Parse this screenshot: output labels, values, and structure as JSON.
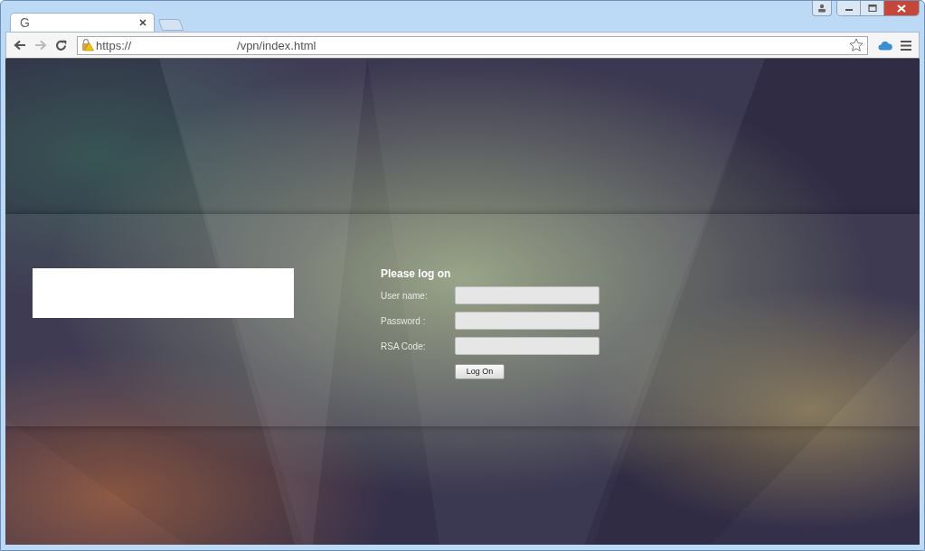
{
  "browser": {
    "tabs": [
      {
        "title": "G",
        "selected": true
      }
    ],
    "address_bar": {
      "scheme": "https://",
      "path": "/vpn/index.html"
    }
  },
  "login": {
    "heading": "Please log on",
    "fields": [
      {
        "label": "User name:"
      },
      {
        "label": "Password :"
      },
      {
        "label": "RSA Code:"
      }
    ],
    "button": "Log On"
  }
}
